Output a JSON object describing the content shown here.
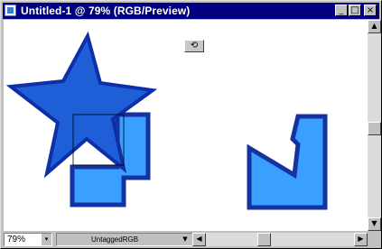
{
  "window": {
    "title": "Untitled-1 @ 79% (RGB/Preview)",
    "controls": {
      "minimize": "_",
      "maximize": "□",
      "close": "×"
    }
  },
  "canvas": {
    "floating_button_icon": "rotate-icon",
    "floating_button_glyph": "⟲",
    "shapes": {
      "star": {
        "fill": "#1e5fd8",
        "stroke": "#0f2fa8"
      },
      "l_block": {
        "fill": "#3aa0ff",
        "stroke": "#1432a0"
      },
      "cut_block": {
        "fill": "#3aa0ff",
        "stroke": "#1432a0"
      }
    }
  },
  "status": {
    "zoom": "79%",
    "zoom_dropdown": "▾",
    "profile": "UntaggedRGB",
    "profile_dropdown": "▼"
  },
  "scrollbars": {
    "up": "▲",
    "down": "▼",
    "left": "◀",
    "right": "▶"
  }
}
